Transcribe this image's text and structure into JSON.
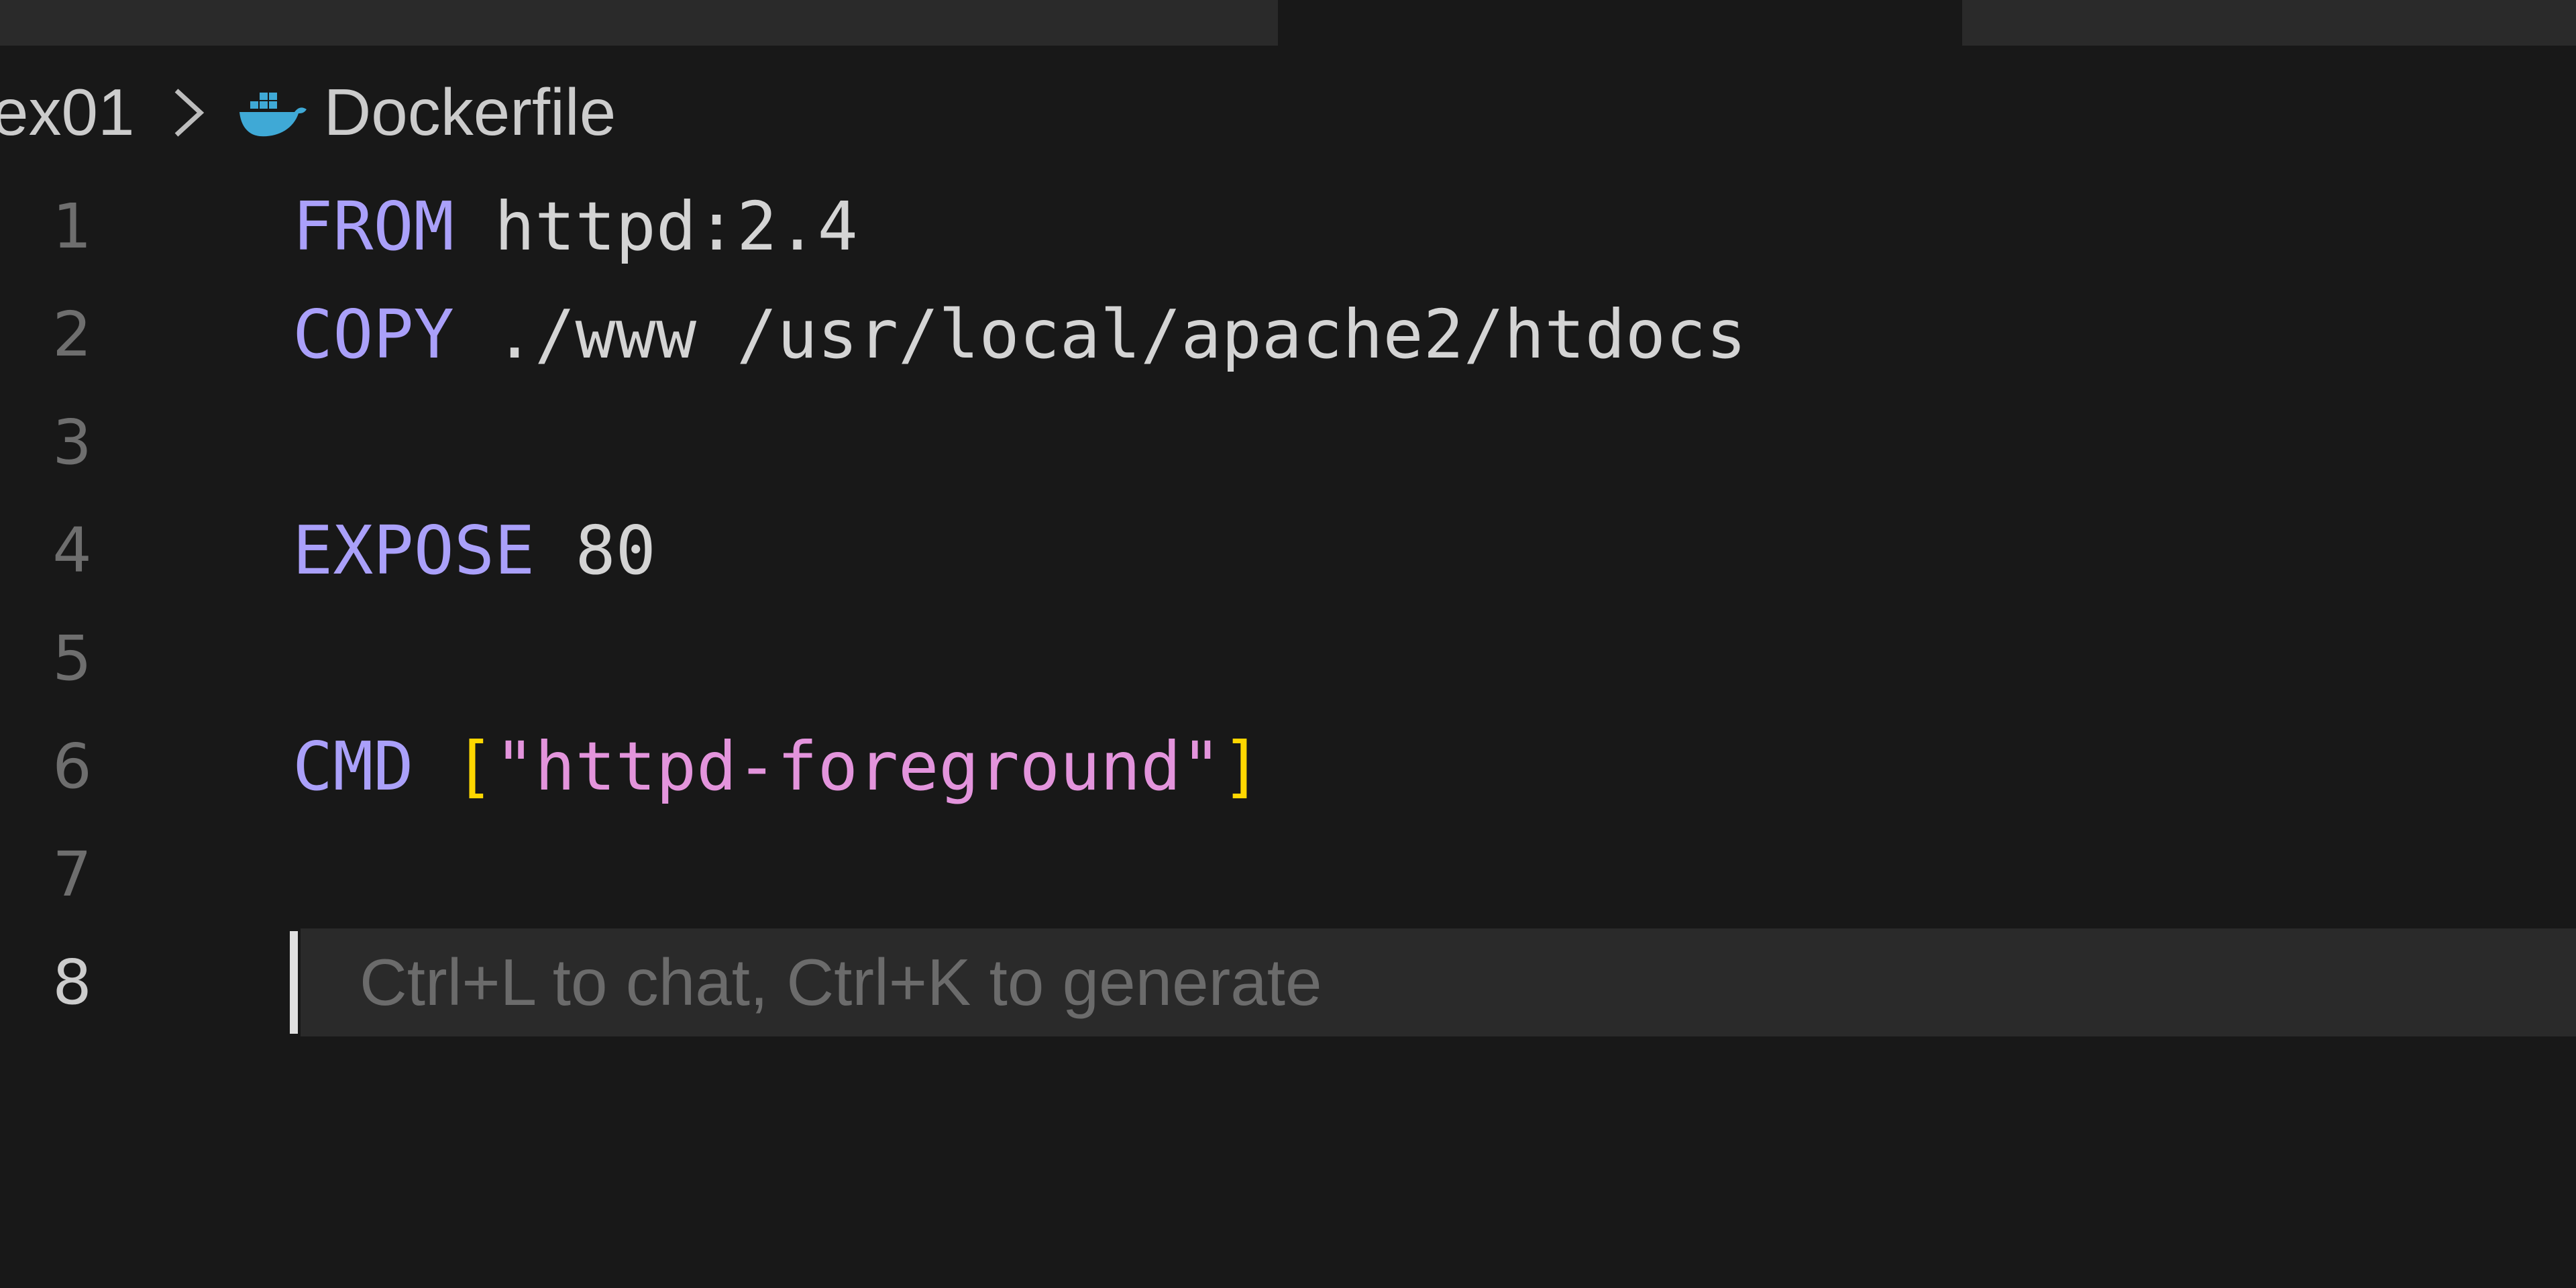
{
  "tabs": [
    {
      "label": "",
      "state": "inactive"
    },
    {
      "label": "",
      "state": "active"
    },
    {
      "label": "",
      "state": "inactive"
    }
  ],
  "breadcrumb": {
    "folder": "ex01",
    "separator_icon": "chevron-right-icon",
    "file_icon": "docker-icon",
    "file": "Dockerfile"
  },
  "colors": {
    "background": "#181818",
    "keyword": "#aaa0fa",
    "string": "#e394dc",
    "bracket": "#ffd700",
    "text": "#d4d4d4",
    "docker_blue": "#3fa9d6"
  },
  "editor": {
    "lines": [
      {
        "number": "1",
        "keyword": "FROM",
        "rest": " httpd:2.4"
      },
      {
        "number": "2",
        "keyword": "COPY",
        "rest": " ./www /usr/local/apache2/htdocs"
      },
      {
        "number": "3"
      },
      {
        "number": "4",
        "keyword": "EXPOSE",
        "rest": " 80"
      },
      {
        "number": "5"
      },
      {
        "number": "6",
        "keyword": "CMD",
        "space": " ",
        "open": "[",
        "string": "\"httpd-foreground\"",
        "close": "]"
      },
      {
        "number": "7"
      },
      {
        "number": "8"
      }
    ],
    "current_line": "8",
    "inline_hint": "Ctrl+L to chat, Ctrl+K to generate"
  }
}
